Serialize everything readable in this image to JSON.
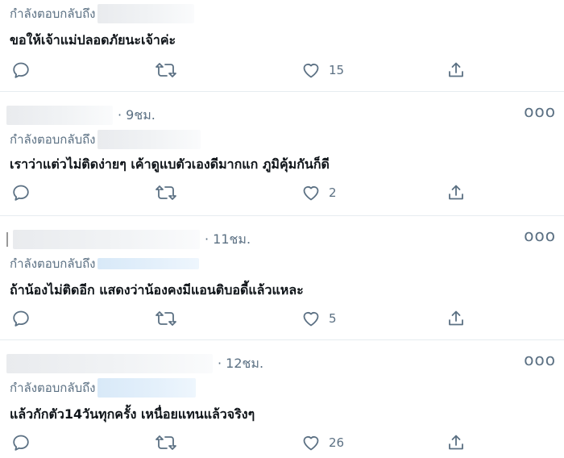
{
  "reply_label": "กำลังตอบกลับถึง",
  "more_symbol": "ooo",
  "icons": {
    "reply": "reply-icon",
    "retweet": "retweet-icon",
    "like": "heart-icon",
    "share": "share-icon",
    "more": "more-icon"
  },
  "colors": {
    "muted": "#5b7083",
    "text": "#0f1419",
    "divider": "#e6ecf0"
  },
  "tweets": [
    {
      "time": "",
      "text": "ขอให้เจ้าแม่ปลอดภัยนะเจ้าค่ะ",
      "likes": "15"
    },
    {
      "time": "· 9ชม.",
      "text": "เราว่าแต่วไม่ติดง่ายๆ เค้าดูแบตัวเองดีมากแก ภูมิคุ้มกันก็ดี",
      "likes": "2"
    },
    {
      "time": "· 11ชม.",
      "text": "ถ้าน้องไม่ติดอีก แสดงว่าน้องคงมีแอนติบอดี้แล้วแหละ",
      "likes": "5"
    },
    {
      "time": "· 12ชม.",
      "text": "แล้วกักตัว14วันทุกครั้ง เหนื่อยแทนแล้วจริงๆ",
      "likes": "26"
    }
  ]
}
